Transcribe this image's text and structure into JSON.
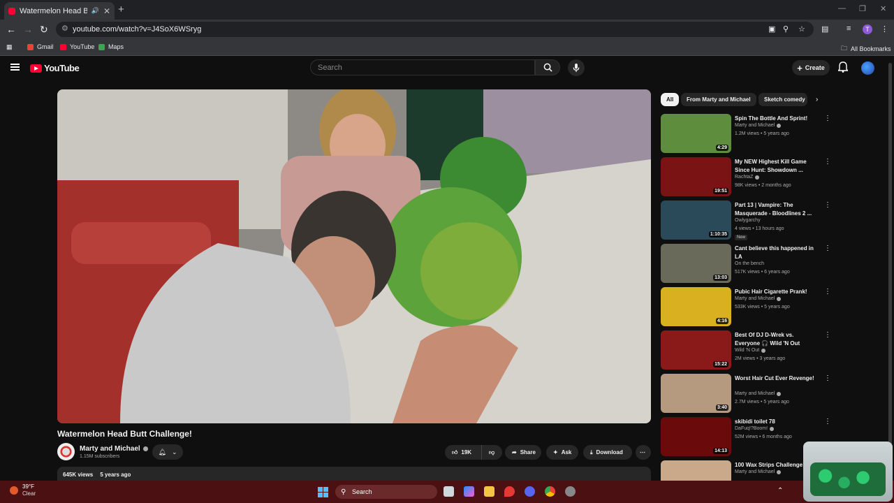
{
  "browser": {
    "tab_title": "Watermelon Head Butt Challenge",
    "url": "youtube.com/watch?v=J4SoX6WSryg",
    "profile_initial": "T",
    "bookmarks": [
      "Gmail",
      "YouTube",
      "Maps"
    ],
    "all_bookmarks": "All Bookmarks"
  },
  "header": {
    "logo_text": "YouTube",
    "search_placeholder": "Search",
    "create_label": "Create"
  },
  "video": {
    "title": "Watermelon Head Butt Challenge!",
    "channel": "Marty and Michael",
    "subscribers": "1.15M subscribers",
    "likes": "19K",
    "share_label": "Share",
    "ask_label": "Ask",
    "download_label": "Download",
    "views": "645K views",
    "age": "5 years ago"
  },
  "chips": [
    "All",
    "From Marty and Michael",
    "Sketch comedy"
  ],
  "recommendations": [
    {
      "title": "Spin The Bottle And Sprint!",
      "channel": "Marty and Michael",
      "verified": true,
      "meta": "1.2M views • 5 years ago",
      "duration": "4:29",
      "thumb_color": "#5f8d3e"
    },
    {
      "title": "My NEW Highest Kill Game Since Hunt: Showdown ...",
      "channel": "RachtaZ",
      "verified": true,
      "meta": "98K views • 2 months ago",
      "duration": "19:51",
      "thumb_color": "#7a1414"
    },
    {
      "title": "Part 13 | Vampire: The Masquerade - Bloodlines 2 ...",
      "channel": "Owlygarchy",
      "verified": false,
      "meta": "4 views • 13 hours ago",
      "badge": "New",
      "duration": "1:10:35",
      "thumb_color": "#2a4a5a"
    },
    {
      "title": "Cant believe this happened in LA",
      "channel": "On the bench",
      "verified": false,
      "meta": "517K views • 6 years ago",
      "duration": "13:03",
      "thumb_color": "#6a6a5a"
    },
    {
      "title": "Pubic Hair Cigarette Prank!",
      "channel": "Marty and Michael",
      "verified": true,
      "meta": "533K views • 5 years ago",
      "duration": "4:16",
      "thumb_color": "#d8b020"
    },
    {
      "title": "Best Of DJ D-Wrek vs. Everyone 🎧 Wild 'N Out",
      "channel": "Wild 'N Out",
      "verified": true,
      "meta": "2M views • 3 years ago",
      "duration": "15:22",
      "thumb_color": "#8a1a1a"
    },
    {
      "title": "Worst Hair Cut Ever Revenge!",
      "channel": "Marty and Michael",
      "verified": true,
      "meta": "2.7M views • 5 years ago",
      "duration": "3:40",
      "thumb_color": "#b59a80"
    },
    {
      "title": "skibidi toilet 78",
      "channel": "DaFuq!?Boom!",
      "verified": true,
      "meta": "52M views • 6 months ago",
      "duration": "14:13",
      "thumb_color": "#6a0a0a"
    },
    {
      "title": "100 Wax Strips Challenge!",
      "channel": "Marty and Michael",
      "verified": true,
      "meta": "",
      "duration": "",
      "thumb_color": "#c9a98a"
    }
  ],
  "taskbar": {
    "temperature": "39°F",
    "condition": "Clear",
    "search_label": "Search"
  },
  "colors": {
    "accent": "#ff0033",
    "taskbar": "#4a1012",
    "background": "#0f0f0f"
  }
}
